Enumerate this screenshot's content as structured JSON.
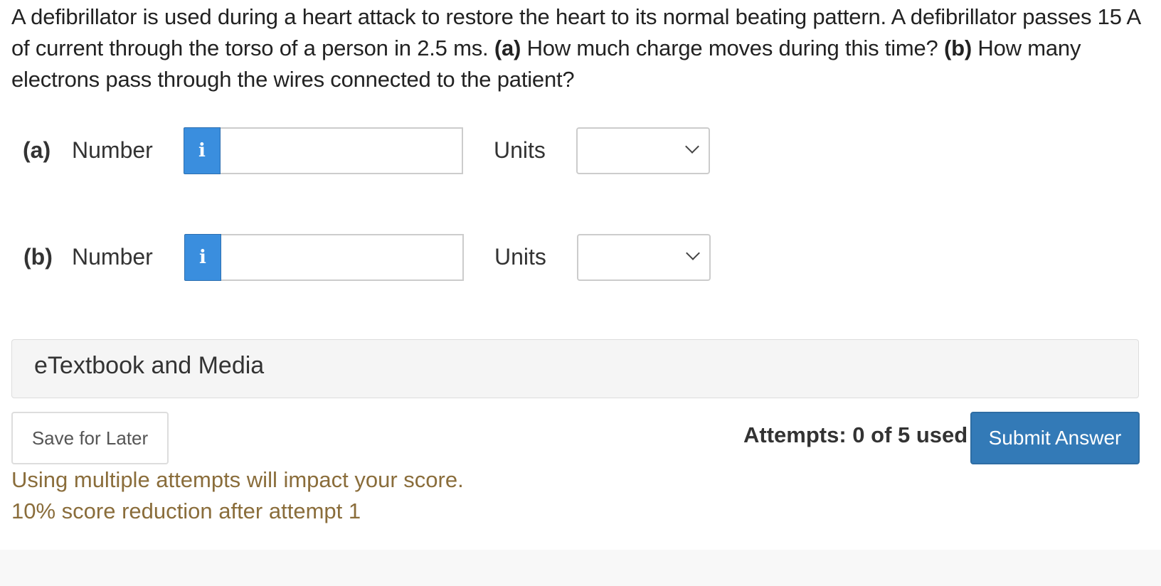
{
  "question": {
    "text_1": "A defibrillator is used during a heart attack to restore the heart to its normal beating pattern. A defibrillator passes 15 A of current through the torso of a person in 2.5 ms. ",
    "part_a_marker": "(a)",
    "text_2": " How much charge moves during this time? ",
    "part_b_marker": "(b)",
    "text_3": " How many electrons pass through the wires connected to the patient?"
  },
  "part_a": {
    "label": "(a)",
    "number_label": "Number",
    "info_icon": "i",
    "number_value": "",
    "units_label": "Units",
    "units_selected": ""
  },
  "part_b": {
    "label": "(b)",
    "number_label": "Number",
    "info_icon": "i",
    "number_value": "",
    "units_label": "Units",
    "units_selected": ""
  },
  "etextbook": {
    "title": "eTextbook and Media"
  },
  "actions": {
    "save_label": "Save for Later",
    "attempts_text": "Attempts: 0 of 5 used",
    "submit_label": "Submit Answer"
  },
  "warning": {
    "line_1": "Using multiple attempts will impact your score.",
    "line_2": "10% score reduction after attempt 1"
  },
  "colors": {
    "info_button": "#3a8ede",
    "submit_button": "#337ab7",
    "warning_text": "#8a6d3b",
    "panel_background": "#f5f5f5"
  },
  "icons": {
    "info": "info-icon",
    "select_arrow": "chevron-down-icon"
  }
}
